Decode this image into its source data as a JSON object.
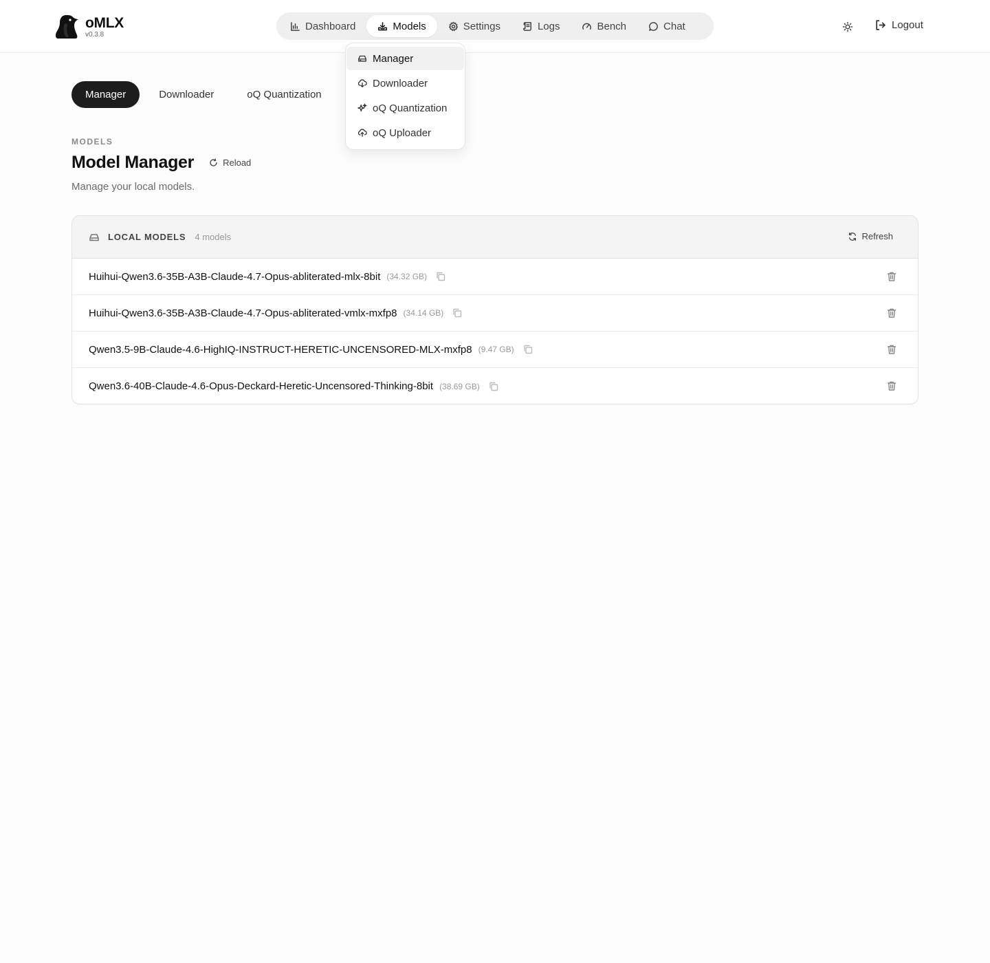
{
  "app": {
    "name": "oMLX",
    "version": "v0.3.8"
  },
  "nav": {
    "items": [
      {
        "label": "Dashboard",
        "icon": "bar-chart-icon"
      },
      {
        "label": "Models",
        "icon": "download-tray-icon",
        "active": true
      },
      {
        "label": "Settings",
        "icon": "gear-icon"
      },
      {
        "label": "Logs",
        "icon": "scroll-icon"
      },
      {
        "label": "Bench",
        "icon": "gauge-icon"
      },
      {
        "label": "Chat",
        "icon": "chat-bubble-icon"
      }
    ],
    "theme_icon": "sun-icon",
    "logout_label": "Logout"
  },
  "dropdown": {
    "items": [
      {
        "label": "Manager",
        "icon": "drive-icon",
        "active": true
      },
      {
        "label": "Downloader",
        "icon": "cloud-download-icon"
      },
      {
        "label": "oQ Quantization",
        "icon": "sparkles-icon"
      },
      {
        "label": "oQ Uploader",
        "icon": "cloud-upload-icon"
      }
    ]
  },
  "subtabs": [
    "Manager",
    "Downloader",
    "oQ Quantization"
  ],
  "page": {
    "kicker": "MODELS",
    "title": "Model Manager",
    "reload_label": "Reload",
    "subtitle": "Manage your local models."
  },
  "card": {
    "title": "LOCAL MODELS",
    "count": "4 models",
    "refresh_label": "Refresh",
    "models": [
      {
        "name": "Huihui-Qwen3.6-35B-A3B-Claude-4.7-Opus-abliterated-mlx-8bit",
        "size": "(34.32 GB)"
      },
      {
        "name": "Huihui-Qwen3.6-35B-A3B-Claude-4.7-Opus-abliterated-vmlx-mxfp8",
        "size": "(34.14 GB)"
      },
      {
        "name": "Qwen3.5-9B-Claude-4.6-HighIQ-INSTRUCT-HERETIC-UNCENSORED-MLX-mxfp8",
        "size": "(9.47 GB)"
      },
      {
        "name": "Qwen3.6-40B-Claude-4.6-Opus-Deckard-Heretic-Uncensored-Thinking-8bit",
        "size": "(38.69 GB)"
      }
    ]
  }
}
